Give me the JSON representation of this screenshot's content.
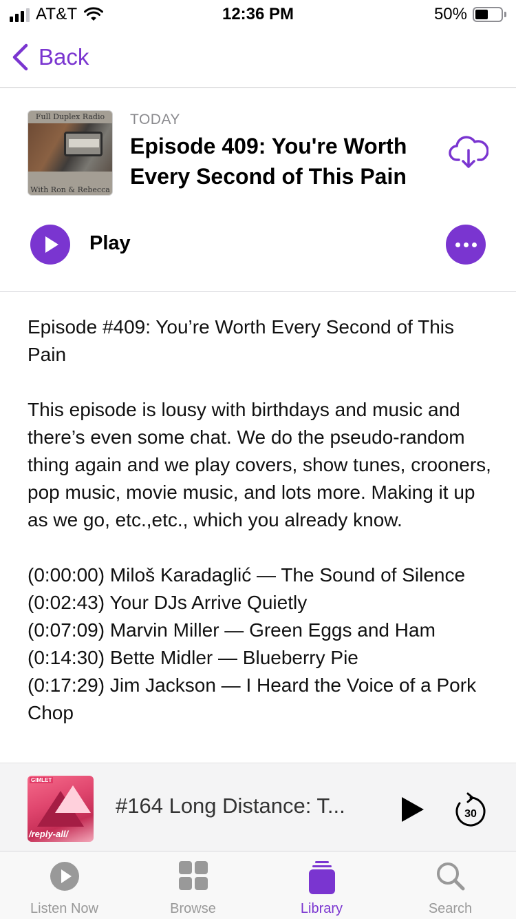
{
  "status_bar": {
    "carrier": "AT&T",
    "time": "12:36 PM",
    "battery_percent": "50%",
    "battery_level": 0.5
  },
  "nav": {
    "back_label": "Back"
  },
  "episode": {
    "artwork_top_text": "Full Duplex Radio",
    "artwork_bottom_text": "With Ron & Rebecca",
    "date_label": "TODAY",
    "title": "Episode 409: You're Worth Every Second of This Pain",
    "play_label": "Play"
  },
  "description": {
    "heading": "Episode #409: You’re Worth Every Second of This Pain",
    "body": "This episode is lousy with birthdays and music and there’s even some chat. We do the pseudo-random thing again and we play covers, show tunes, crooners, pop music, movie music, and lots more. Making it up as we go, etc.,etc., which you already know.",
    "tracks": [
      "(0:00:00) Miloš Karadaglić — The Sound of Silence",
      "(0:02:43) Your DJs Arrive Quietly",
      "(0:07:09) Marvin Miller — Green Eggs and Ham",
      "(0:14:30) Bette Midler — Blueberry Pie",
      "(0:17:29) Jim Jackson — I Heard the Voice of a Pork Chop"
    ]
  },
  "mini_player": {
    "title": "#164 Long Distance: T...",
    "artwork_text": "/reply-all/",
    "skip_seconds": "30"
  },
  "tab_bar": {
    "tabs": [
      {
        "label": "Listen Now",
        "icon": "play-circle-icon",
        "active": false
      },
      {
        "label": "Browse",
        "icon": "grid-icon",
        "active": false
      },
      {
        "label": "Library",
        "icon": "library-stack-icon",
        "active": true
      },
      {
        "label": "Search",
        "icon": "search-icon",
        "active": false
      }
    ]
  },
  "colors": {
    "accent": "#7a35d0",
    "inactive_tab": "#999999"
  }
}
